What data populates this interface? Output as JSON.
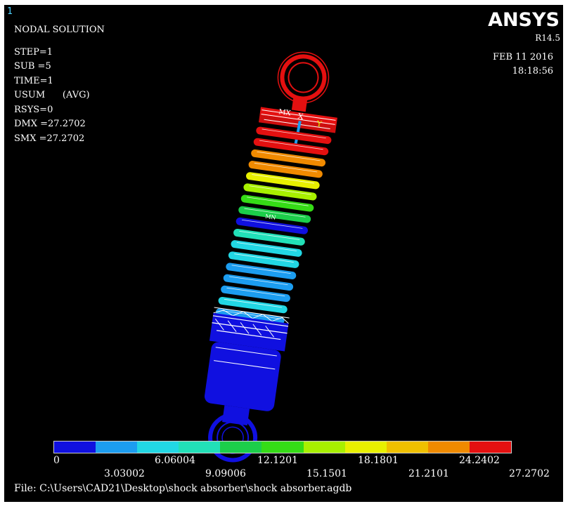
{
  "window": {
    "number": "1"
  },
  "header": {
    "title": "NODAL SOLUTION",
    "rows": [
      "STEP=1",
      "SUB =5",
      "TIME=1",
      "USUM      (AVG)",
      "RSYS=0",
      "DMX =27.2702",
      "SMX =27.2702"
    ]
  },
  "brand": {
    "logo": "ANSYS",
    "version": "R14.5"
  },
  "stamp": {
    "date": "FEB 11 2016",
    "time": "18:18:56"
  },
  "model_labels": {
    "mx_top": "MX",
    "x_axis": "X",
    "y_axis": "Y",
    "mn": "MN"
  },
  "legend": {
    "colors": [
      "#1010e0",
      "#1c9df0",
      "#22d7e4",
      "#22e0b8",
      "#1cce4a",
      "#35dc16",
      "#a8f000",
      "#e8f000",
      "#f0c000",
      "#f08a00",
      "#e41010"
    ],
    "labels_top": [
      "0",
      "6.06004",
      "12.1201",
      "18.1801",
      "24.2402"
    ],
    "labels_bottom": [
      "3.03002",
      "9.09006",
      "15.1501",
      "21.2101",
      "27.2702"
    ]
  },
  "status": {
    "file": "File: C:\\Users\\CAD21\\Desktop\\shock absorber\\shock absorber.agdb"
  }
}
